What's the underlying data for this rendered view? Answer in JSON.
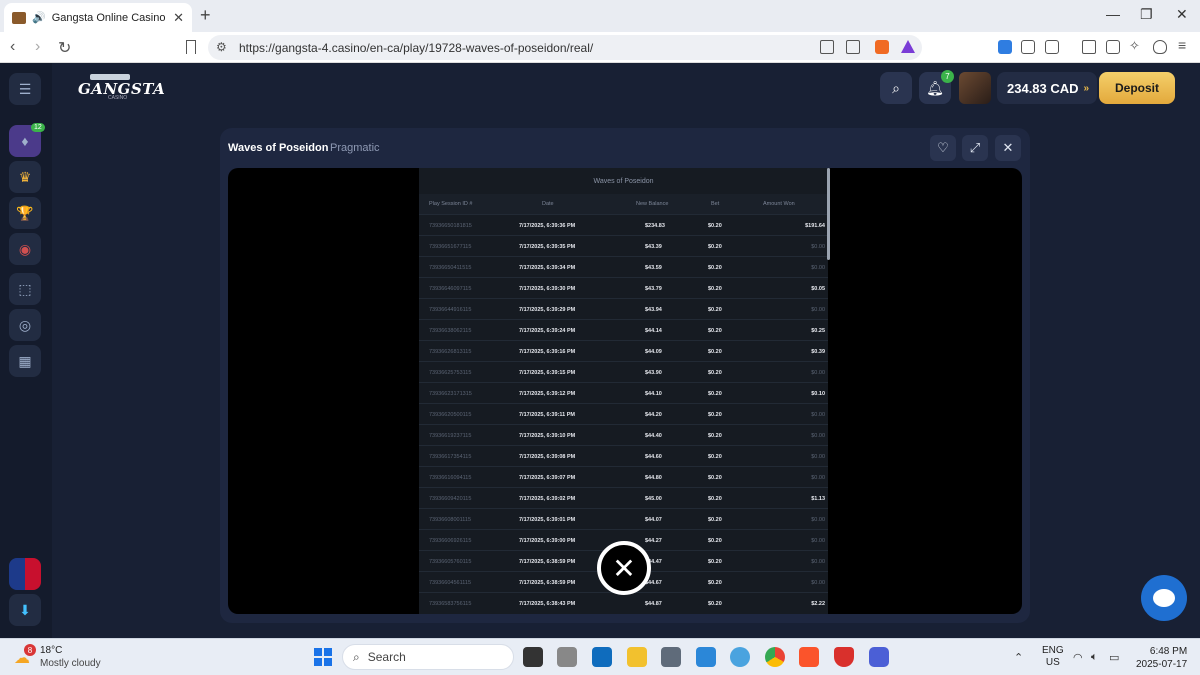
{
  "browser": {
    "tab_title": "Gangsta Online Casino | Gang",
    "url": "https://gangsta-4.casino/en-ca/play/19728-waves-of-poseidon/real/"
  },
  "header": {
    "logo_text": "GANGSTA",
    "logo_sub": "CASINO",
    "notifications_count": "7",
    "balance": "234.83 CAD",
    "deposit_label": "Deposit"
  },
  "sidebar": {
    "badge": "12"
  },
  "game": {
    "title": "Waves of Poseidon",
    "provider": "Pragmatic"
  },
  "history": {
    "title": "Waves of Poseidon",
    "columns": [
      "Play Session ID #",
      "Date",
      "New Balance",
      "Bet",
      "Amount Won"
    ],
    "rows": [
      {
        "id": "73936650181815",
        "date": "7/17/2025, 6:39:36 PM",
        "balance": "$234.83",
        "bet": "$0.20",
        "won": "$191.64"
      },
      {
        "id": "73936651677115",
        "date": "7/17/2025, 6:39:35 PM",
        "balance": "$43.39",
        "bet": "$0.20",
        "won": "$0.00"
      },
      {
        "id": "73936650411515",
        "date": "7/17/2025, 6:39:34 PM",
        "balance": "$43.59",
        "bet": "$0.20",
        "won": "$0.00"
      },
      {
        "id": "73936646097115",
        "date": "7/17/2025, 6:39:30 PM",
        "balance": "$43.79",
        "bet": "$0.20",
        "won": "$0.05"
      },
      {
        "id": "73936644916115",
        "date": "7/17/2025, 6:39:29 PM",
        "balance": "$43.94",
        "bet": "$0.20",
        "won": "$0.00"
      },
      {
        "id": "73936638062115",
        "date": "7/17/2025, 6:39:24 PM",
        "balance": "$44.14",
        "bet": "$0.20",
        "won": "$0.25"
      },
      {
        "id": "73936626813115",
        "date": "7/17/2025, 6:39:16 PM",
        "balance": "$44.09",
        "bet": "$0.20",
        "won": "$0.39"
      },
      {
        "id": "73936625753115",
        "date": "7/17/2025, 6:39:15 PM",
        "balance": "$43.90",
        "bet": "$0.20",
        "won": "$0.00"
      },
      {
        "id": "73936623171315",
        "date": "7/17/2025, 6:39:12 PM",
        "balance": "$44.10",
        "bet": "$0.20",
        "won": "$0.10"
      },
      {
        "id": "73936620500115",
        "date": "7/17/2025, 6:39:11 PM",
        "balance": "$44.20",
        "bet": "$0.20",
        "won": "$0.00"
      },
      {
        "id": "73936619237115",
        "date": "7/17/2025, 6:39:10 PM",
        "balance": "$44.40",
        "bet": "$0.20",
        "won": "$0.00"
      },
      {
        "id": "73936617354115",
        "date": "7/17/2025, 6:39:08 PM",
        "balance": "$44.60",
        "bet": "$0.20",
        "won": "$0.00"
      },
      {
        "id": "73936616094115",
        "date": "7/17/2025, 6:39:07 PM",
        "balance": "$44.80",
        "bet": "$0.20",
        "won": "$0.00"
      },
      {
        "id": "73936609420115",
        "date": "7/17/2025, 6:39:02 PM",
        "balance": "$45.00",
        "bet": "$0.20",
        "won": "$1.13"
      },
      {
        "id": "73936608001115",
        "date": "7/17/2025, 6:39:01 PM",
        "balance": "$44.07",
        "bet": "$0.20",
        "won": "$0.00"
      },
      {
        "id": "73936606926115",
        "date": "7/17/2025, 6:39:00 PM",
        "balance": "$44.27",
        "bet": "$0.20",
        "won": "$0.00"
      },
      {
        "id": "73936605760115",
        "date": "7/17/2025, 6:38:59 PM",
        "balance": "$44.47",
        "bet": "$0.20",
        "won": "$0.00"
      },
      {
        "id": "73936604561115",
        "date": "7/17/2025, 6:38:59 PM",
        "balance": "$44.67",
        "bet": "$0.20",
        "won": "$0.00"
      },
      {
        "id": "73936583756115",
        "date": "7/17/2025, 6:38:43 PM",
        "balance": "$44.87",
        "bet": "$0.20",
        "won": "$2.22"
      }
    ]
  },
  "taskbar": {
    "weather_badge": "8",
    "temperature": "18°C",
    "weather": "Mostly cloudy",
    "search_label": "Search",
    "lang_line1": "ENG",
    "lang_line2": "US",
    "time": "6:48 PM",
    "date": "2025-07-17"
  }
}
